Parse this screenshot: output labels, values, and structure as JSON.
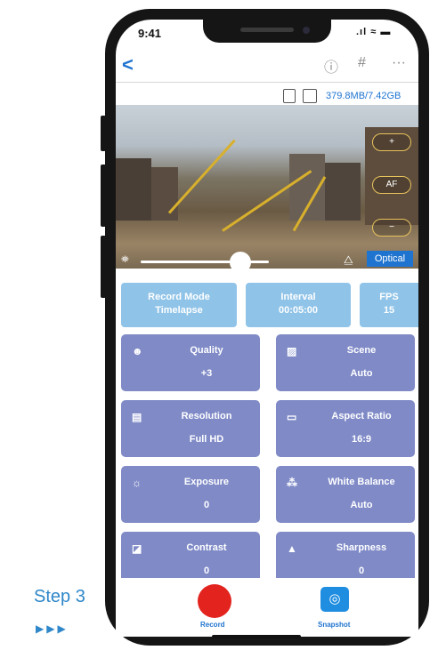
{
  "status": {
    "time": "9:41",
    "icons": "..ıl ≈ ▬"
  },
  "nav": {
    "back_label": "<",
    "info_icon": "ⓘ",
    "grid_icon": "#",
    "more_icon": "···"
  },
  "storage": {
    "text": "379.8MB/7.42GB"
  },
  "camera": {
    "zoom_in": "+",
    "af": "AF",
    "zoom_out": "−",
    "optical": "Optical",
    "zoom_level": 0.8
  },
  "top_tiles": [
    {
      "label": "Record Mode",
      "value": "Timelapse"
    },
    {
      "label": "Interval",
      "value": "00:05:00"
    },
    {
      "label": "FPS",
      "value": "15"
    }
  ],
  "settings": [
    {
      "label": "Quality",
      "value": "+3",
      "icon": "☻"
    },
    {
      "label": "Scene",
      "value": "Auto",
      "icon": "▨"
    },
    {
      "label": "Resolution",
      "value": "Full HD",
      "icon": "▤"
    },
    {
      "label": "Aspect Ratio",
      "value": "16:9",
      "icon": "▭"
    },
    {
      "label": "Exposure",
      "value": "0",
      "icon": "☼"
    },
    {
      "label": "White Balance",
      "value": "Auto",
      "icon": "⁂"
    },
    {
      "label": "Contrast",
      "value": "0",
      "icon": "◪"
    },
    {
      "label": "Sharpness",
      "value": "0",
      "icon": "▲"
    }
  ],
  "bottom": {
    "record_label": "Record",
    "snapshot_label": "Snapshot"
  },
  "caption": {
    "step": "Step 3",
    "arrows": "▶▶▶"
  },
  "colors": {
    "accent": "#1f74d0",
    "tile": "#7f8ac7",
    "top_tile": "#8fc3e8",
    "record": "#e3231e"
  }
}
